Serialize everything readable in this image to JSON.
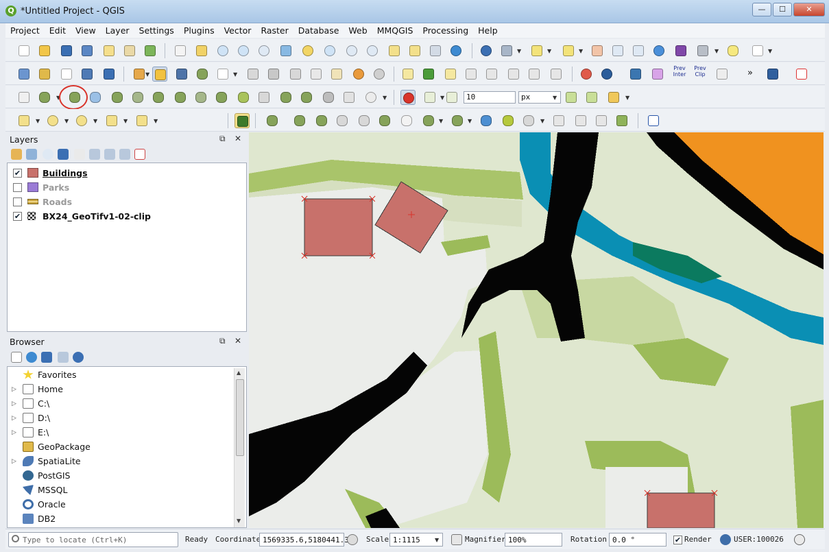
{
  "window": {
    "title": "*Untitled Project - QGIS",
    "app_icon": "Q",
    "minimize": "—",
    "maximize": "☐",
    "close": "✕"
  },
  "menu": [
    "Project",
    "Edit",
    "View",
    "Layer",
    "Settings",
    "Plugins",
    "Vector",
    "Raster",
    "Database",
    "Web",
    "MMQGIS",
    "Processing",
    "Help"
  ],
  "toolbar2": {
    "prev_inter": "Prev Inter",
    "prev_clip": "Prev Clip",
    "more": "»"
  },
  "toolbar3": {
    "snap_tolerance": "10",
    "snap_units": "px"
  },
  "layers_panel": {
    "title": "Layers",
    "layers": [
      {
        "name": "Buildings",
        "checked": true,
        "active": true,
        "color": "#c8716b"
      },
      {
        "name": "Parks",
        "checked": false,
        "active": false,
        "color": "#9a7bd6"
      },
      {
        "name": "Roads",
        "checked": false,
        "active": false,
        "color": "#c6a23b"
      },
      {
        "name": "BX24_GeoTifv1-02-clip",
        "checked": true,
        "active": true,
        "color": "#333333"
      }
    ]
  },
  "browser_panel": {
    "title": "Browser",
    "items": [
      {
        "label": "Favorites",
        "icon": "star-icon",
        "expandable": false
      },
      {
        "label": "Home",
        "icon": "folder-icon",
        "expandable": true
      },
      {
        "label": "C:\\",
        "icon": "folder-icon",
        "expandable": true
      },
      {
        "label": "D:\\",
        "icon": "folder-icon",
        "expandable": true
      },
      {
        "label": "E:\\",
        "icon": "folder-icon",
        "expandable": true
      },
      {
        "label": "GeoPackage",
        "icon": "geopackage-icon",
        "expandable": false
      },
      {
        "label": "SpatiaLite",
        "icon": "feather-icon",
        "expandable": true
      },
      {
        "label": "PostGIS",
        "icon": "elephant-icon",
        "expandable": false
      },
      {
        "label": "MSSQL",
        "icon": "mssql-icon",
        "expandable": false
      },
      {
        "label": "Oracle",
        "icon": "oracle-icon",
        "expandable": false
      },
      {
        "label": "DB2",
        "icon": "db2-icon",
        "expandable": false
      }
    ]
  },
  "status": {
    "locator_placeholder": "Type to locate (Ctrl+K)",
    "ready": "Ready",
    "coordinate_label": "Coordinate",
    "coordinate": "1569335.6,5180441.3",
    "scale_label": "Scale",
    "scale": "1:1115",
    "magnifier_label": "Magnifier",
    "magnifier": "100%",
    "rotation_label": "Rotation",
    "rotation": "0.0 °",
    "render_label": "Render",
    "render_checked": true,
    "crs": "USER:100026"
  },
  "colors": {
    "building_fill": "#c8716b",
    "raster_bg": "#dfe7cf",
    "road_black": "#050505",
    "water_blue": "#0a8fb4",
    "orange": "#f0921f",
    "green_edge": "#9cbb5a",
    "light_gray": "#ebedea"
  }
}
